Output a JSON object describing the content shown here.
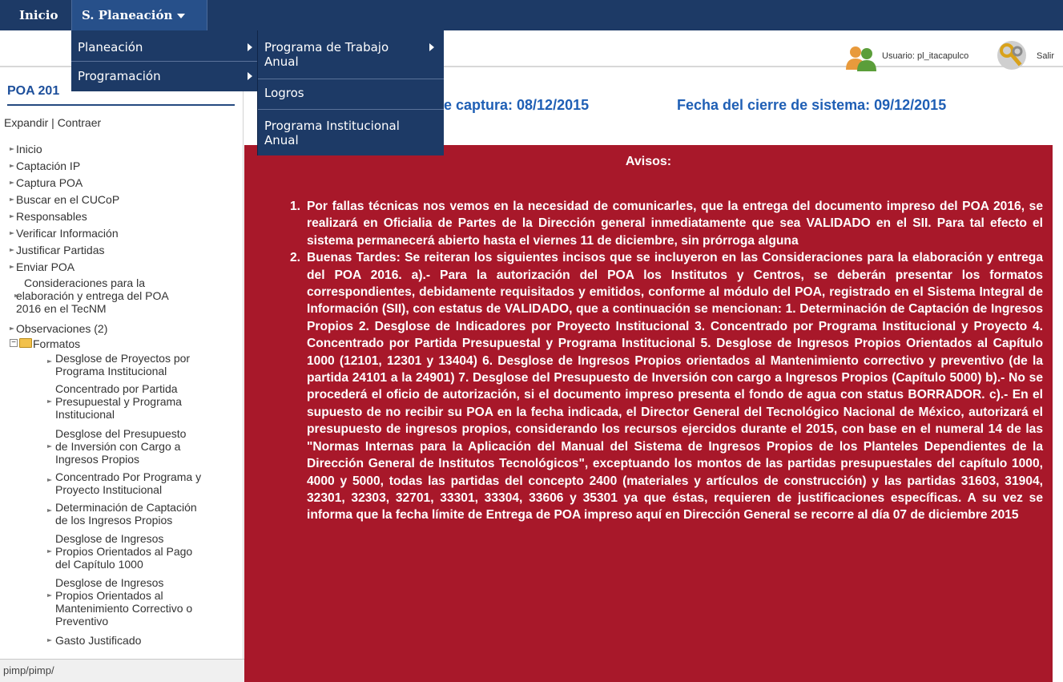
{
  "nav": {
    "inicio": "Inicio",
    "planeacion": "S. Planeación"
  },
  "menu1": {
    "items": [
      "Planeación",
      "Programación"
    ]
  },
  "menu2": {
    "item1_line1": "Programa de Trabajo",
    "item1_line2": "Anual",
    "item2": "Logros",
    "item3_line1": "Programa Institucional",
    "item3_line2": "Anual"
  },
  "user": {
    "label": "Usuario: pl_itacapulco",
    "logout": "Salir"
  },
  "sidebar": {
    "title": "POA 201",
    "expand": "Expandir",
    "separator": " | ",
    "collapse": "Contraer",
    "items": [
      "Inicio",
      "Captación IP",
      "Captura POA",
      "Buscar en el CUCoP",
      "Responsables",
      "Verificar Información",
      "Justificar Partidas",
      "Enviar POA"
    ],
    "consideraciones": [
      "Consideraciones para la",
      "elaboración y entrega del POA",
      "2016 en el TecNM"
    ],
    "observaciones": "Observaciones (2)",
    "folder": "Formatos",
    "formatos": [
      [
        "Desglose de Proyectos por",
        "Programa Institucional"
      ],
      [
        "Concentrado por Partida",
        "Presupuestal y Programa",
        "Institucional"
      ],
      [
        "Desglose del Presupuesto",
        "de Inversión con Cargo a",
        "Ingresos Propios"
      ],
      [
        "Concentrado Por Programa y",
        "Proyecto Institucional"
      ],
      [
        "Determinación de Captación",
        "de los Ingresos Propios"
      ],
      [
        "Desglose de Ingresos",
        "Propios Orientados al Pago",
        "del Capítulo 1000"
      ],
      [
        "Desglose de Ingresos",
        "Propios Orientados al",
        "Mantenimiento Correctivo o",
        "Preventivo"
      ],
      [
        "Gasto Justificado"
      ]
    ]
  },
  "status_url": "pimp/pimp/",
  "dates": {
    "capture": "e captura: 08/12/2015",
    "close": "Fecha del cierre de sistema: 09/12/2015"
  },
  "notice": {
    "title": "Avisos:",
    "items": [
      {
        "num": "1.",
        "text": "Por fallas técnicas nos vemos en la necesidad de comunicarles, que la entrega del documento impreso del POA 2016, se realizará en Oficialia de Partes de la Dirección general inmediatamente que sea VALIDADO en el SII. Para tal efecto el sistema permanecerá abierto hasta el viernes 11 de diciembre, sin prórroga alguna"
      },
      {
        "num": "2.",
        "text": "Buenas Tardes: Se reiteran los siguientes incisos que se incluyeron en las Consideraciones para la elaboración y entrega del POA 2016. a).- Para la autorización del POA los Institutos y Centros, se deberán presentar los formatos correspondientes, debidamente requisitados y emitidos, conforme al módulo del POA, registrado en el Sistema Integral de Información (SII), con estatus de VALIDADO, que a continuación se mencionan: 1. Determinación de Captación de Ingresos Propios 2. Desglose de Indicadores por Proyecto Institucional 3. Concentrado por Programa Institucional y Proyecto 4. Concentrado por Partida Presupuestal y Programa Institucional 5. Desglose de Ingresos Propios Orientados al Capítulo 1000 (12101, 12301 y 13404) 6. Desglose de Ingresos Propios orientados al Mantenimiento correctivo y preventivo (de la partida 24101 a la 24901) 7. Desglose del Presupuesto de Inversión con cargo a Ingresos Propios (Capítulo 5000) b).- No se procederá el oficio de autorización, si el documento impreso presenta el fondo de agua con status BORRADOR. c).- En el supuesto de no recibir su POA en la fecha indicada, el Director General del Tecnológico Nacional de México, autorizará el presupuesto de ingresos propios, considerando los recursos ejercidos durante el 2015, con base en el numeral 14 de las \"Normas Internas para la Aplicación del Manual del Sistema de Ingresos Propios de los Planteles Dependientes de la Dirección General de Institutos Tecnológicos\", exceptuando los montos de las partidas presupuestales del capítulo 1000, 4000 y 5000, todas las partidas del concepto 2400 (materiales y artículos de construcción) y las partidas 31603, 31904, 32301, 32303, 32701, 33301, 33304, 33606 y 35301 ya que éstas, requieren de justificaciones específicas. A su vez se informa que la fecha límite de Entrega de POA impreso aquí en Dirección General se recorre al día 07 de diciembre 2015"
      }
    ]
  },
  "colors": {
    "nav_bg": "#1d3a66",
    "notice_bg": "#a8182a",
    "date_text": "#1f5fb5"
  }
}
